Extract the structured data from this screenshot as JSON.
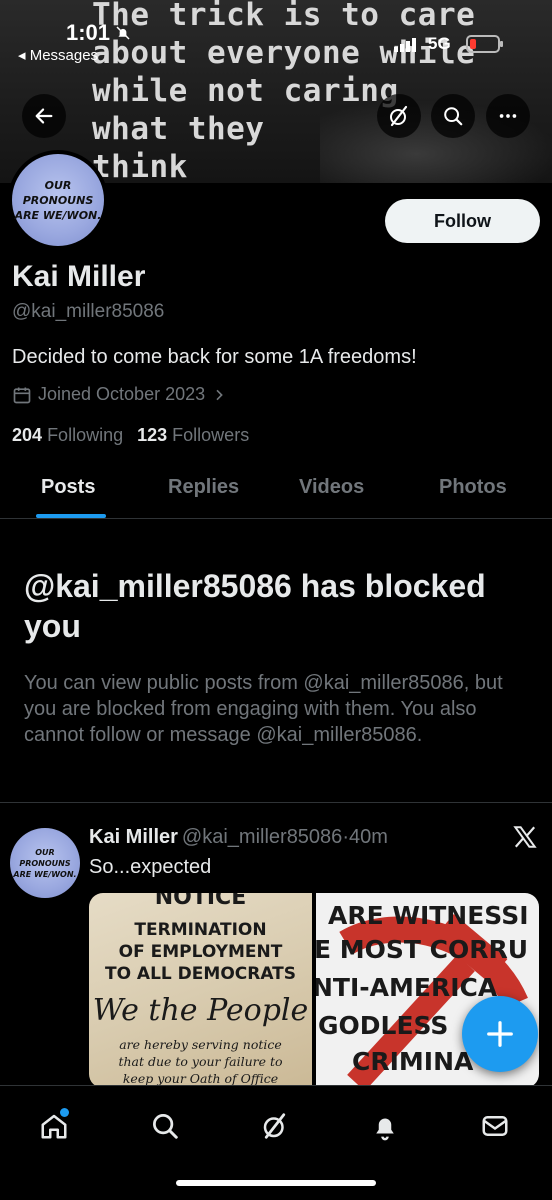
{
  "status_bar": {
    "time": "1:01",
    "back_app": "◂ Messages",
    "network": "5G"
  },
  "banner": {
    "quote": "The trick is to care\nabout everyone while\nwhile not caring\nwhat they\nthink"
  },
  "profile": {
    "avatar_text": "OUR\nPRONOUNS\nARE WE/WON.",
    "follow_label": "Follow",
    "name": "Kai Miller",
    "handle": "@kai_miller85086",
    "bio": "Decided to come back for some 1A freedoms!",
    "joined": "Joined October 2023",
    "following_count": "204",
    "following_label": "Following",
    "followers_count": "123",
    "followers_label": "Followers"
  },
  "tabs": [
    {
      "label": "Posts",
      "active": true
    },
    {
      "label": "Replies"
    },
    {
      "label": "Videos"
    },
    {
      "label": "Photos"
    }
  ],
  "blocked": {
    "title": "@kai_miller85086 has blocked you",
    "description": "You can view public posts from @kai_miller85086, but you are blocked from engaging with them. You also cannot follow or message @kai_miller85086."
  },
  "post": {
    "author_name": "Kai Miller",
    "author_handle": "@kai_miller85086",
    "separator": "·",
    "time": "40m",
    "text": "So...expected",
    "avatar_text": "OUR\nPRONOUNS\nARE WE/WON.",
    "media_left": {
      "notice": "NOTICE",
      "termination": "TERMINATION\nOF EMPLOYMENT\nTO ALL DEMOCRATS",
      "we_the_people": "We the People",
      "small": "are hereby serving notice\nthat due to your failure to\nkeep your Oath of Office"
    },
    "media_right": {
      "line1": "ARE WITNESSI",
      "line2": "E MOST CORRU",
      "line3": "NTI-AMERICA",
      "line4": "GODLESS",
      "line5": "CRIMINA"
    }
  },
  "colors": {
    "accent": "#1d9bf0",
    "background": "#000000",
    "muted_text": "#71767b",
    "primary_text": "#e7e9ea"
  },
  "icons": {
    "back": "arrow-left-icon",
    "grok": "grok-icon",
    "search": "search-icon",
    "more": "more-icon",
    "calendar": "calendar-icon",
    "chevron": "chevron-right-icon",
    "x_logo": "x-logo-icon",
    "compose": "plus-icon",
    "home": "home-icon",
    "explore": "search-icon",
    "grok_nav": "grok-icon",
    "notifications": "bell-icon",
    "messages": "mail-icon"
  }
}
